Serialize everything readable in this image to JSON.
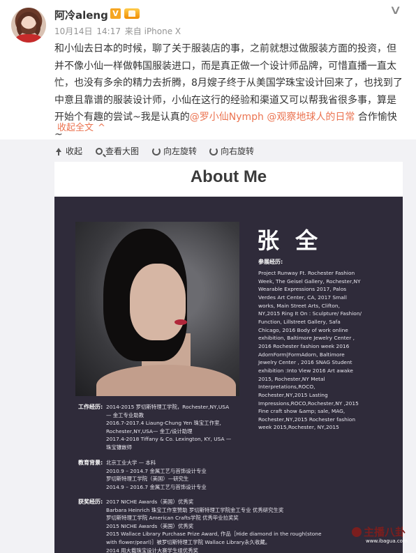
{
  "post": {
    "username": "阿冷aleng丶",
    "verified_mark": "V",
    "date": "10月14日",
    "time": "14:17",
    "source": "来自 iPhone X",
    "text_plain": "和小仙去日本的时候，聊了关于服装店的事，之前就想过做服装方面的投资，但并不像小仙一样做韩国服装进口，而是真正做一个设计师品牌，可惜直播一直太忙，也没有多余的精力去折腾，8月嫂子终于从美国学珠宝设计回来了，也找到了中意且靠谱的服装设计师，小仙在这行的经验和渠道又可以帮我省很多事，算是开始个有趣的尝试~我是认真的",
    "mention1": "@罗小仙Nymph",
    "mention2": "@观察地球人的日常",
    "text_end": "合作愉快~",
    "collapse": "收起全文",
    "caret": "^"
  },
  "toolbar": {
    "collapse": "收起",
    "view_large": "查看大图",
    "rotate_left": "向左旋转",
    "rotate_right": "向右旋转"
  },
  "poster": {
    "title": "About Me",
    "name": "张 全",
    "exhibition_label": "参展经历:",
    "exhibitions": "Project Runway Ft. Rochester Fashion Week, The Geisel Gallery, Rochester,NY Wearable Expressions 2017, Palos Verdes Art Center, CA, 2017 Small works, Main Street Arts, Clifton, NY,2015 Ring It On : Sculpture/ Fashion/ Function, Lillstreet Gallery, Safa Chicago, 2016 Body of work online exhibition, Baltimore Jewelry Center , 2016 Rochester fashion week 2016 AdornForm|FormAdorn, Baltimore Jewelry Center , 2016 SNAG Student exhibition :Into View 2016 Art awake 2015, Rochester,NY Metal Interpretations,ROCO, Rochester,NY,2015 Lasting Impressions,ROCO,Rochester,NY ,2015 Fine craft show &amp; sale, MAG, Rochester,NY,2015 Rochester fashion week 2015,Rochester, NY,2015",
    "work_label": "工作经历:",
    "work": [
      "2014-2015  罗切斯特理工学院，Rochester,NY,USA",
      "— 金工专业助教",
      "2016.7-2017.4  Liaung-Chung Yen 珠宝工作室,",
      "Rochester,NY,USA— 金工/设计助理",
      "2017.4-2018  Tiffany & Co. Lexington, KY, USA —",
      "珠宝镶嵌师"
    ],
    "edu_label": "教育背景:",
    "edu": [
      "北京工业大学 — 本科",
      "2010.9 – 2014.7 金属工艺与首饰设计专业",
      "罗切斯特理工学院（美国）—研究生",
      "2014.9 – 2016.7 金属工艺与首饰设计专业"
    ],
    "award_label": "获奖经历:",
    "awards": [
      "2017 NICHE Awards（美国）优秀奖",
      "Barbara Heinrich 珠宝工作室赞助 罗切斯特理工学院金工专业 优秀研究生奖",
      "罗切斯特理工学院 American Crafts学院 优秀毕业拉奖奖",
      "2015 NICHE Awards（美国）优秀奖",
      "2015 Wallace Library Purchase Prize Award, 作品［Hide diamond in the rough(stone",
      "with flower/pearl)］被罗切斯特理工学院 Wallace Library永久收藏。",
      "2014 用大载珠宝设计大赛学生组优秀奖"
    ]
  },
  "watermark": {
    "text": "主播八卦",
    "url": "www.ibagua.com"
  }
}
